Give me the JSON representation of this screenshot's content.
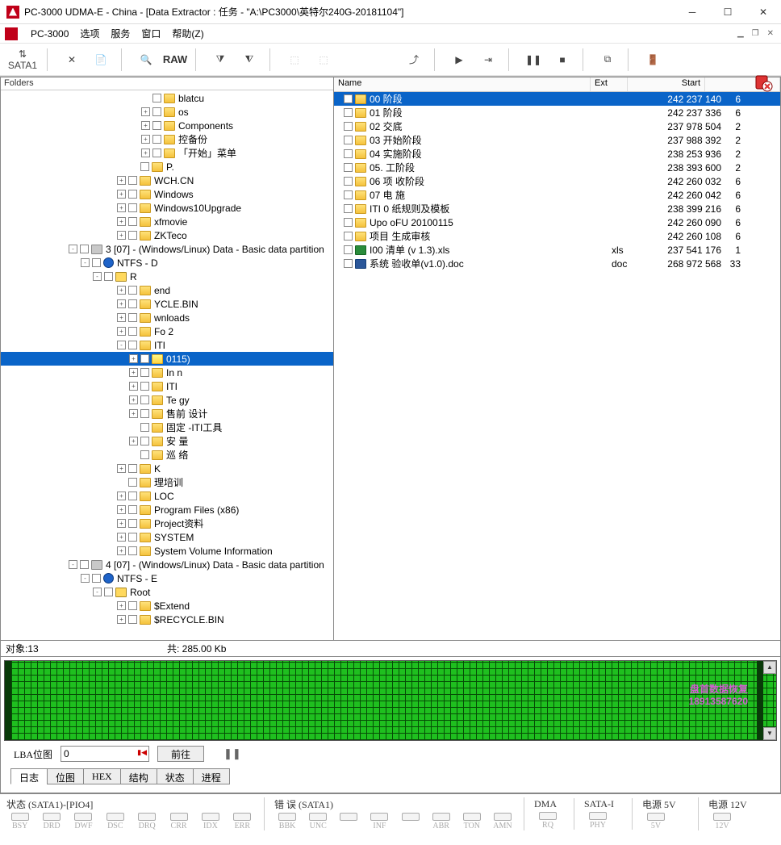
{
  "window": {
    "title": "PC-3000 UDMA-E - China - [Data Extractor : 任务 - \"A:\\PC3000\\英特尔240G-20181104\"]"
  },
  "menu": {
    "pc3000": "PC-3000",
    "options": "选项",
    "services": "服务",
    "window": "窗口",
    "help": "帮助(Z)"
  },
  "toolbar": {
    "sata": "SATA1",
    "raw": "RAW"
  },
  "folders": {
    "title": "Folders",
    "tree": [
      {
        "ind": 170,
        "exp": "",
        "name": "blatcu",
        "blur": true
      },
      {
        "ind": 170,
        "exp": "+",
        "name": "      os",
        "blur": true
      },
      {
        "ind": 170,
        "exp": "+",
        "name": "      Components"
      },
      {
        "ind": 170,
        "exp": "+",
        "name": "     控备份",
        "blur": true
      },
      {
        "ind": 170,
        "exp": "+",
        "name": "     「开始」菜单",
        "blur": true
      },
      {
        "ind": 155,
        "exp": "",
        "name": "P.",
        "blur": true
      },
      {
        "ind": 140,
        "exp": "+",
        "name": "WCH.CN"
      },
      {
        "ind": 140,
        "exp": "+",
        "name": "Windows"
      },
      {
        "ind": 140,
        "exp": "+",
        "name": "Windows10Upgrade"
      },
      {
        "ind": 140,
        "exp": "+",
        "name": "xfmovie"
      },
      {
        "ind": 140,
        "exp": "+",
        "name": "ZKTeco"
      },
      {
        "ind": 80,
        "exp": "-",
        "name": "3 [07] - (Windows/Linux) Data - Basic data partition",
        "icon": "drive"
      },
      {
        "ind": 95,
        "exp": "-",
        "name": "NTFS - D",
        "icon": "ntfs"
      },
      {
        "ind": 110,
        "exp": "-",
        "name": "R",
        "icon": "root",
        "blur": true
      },
      {
        "ind": 140,
        "exp": "+",
        "name": "         end",
        "blur": true
      },
      {
        "ind": 140,
        "exp": "+",
        "name": "         YCLE.BIN",
        "blur": true
      },
      {
        "ind": 140,
        "exp": "+",
        "name": "       wnloads",
        "blur": true
      },
      {
        "ind": 140,
        "exp": "+",
        "name": "Fo       2",
        "blur": true
      },
      {
        "ind": 140,
        "exp": "-",
        "name": "ITI",
        "blur": true
      },
      {
        "ind": 155,
        "exp": "+",
        "name": "                           0115)",
        "sel": true
      },
      {
        "ind": 155,
        "exp": "+",
        "name": "In        n",
        "blur": true
      },
      {
        "ind": 155,
        "exp": "+",
        "name": "ITI",
        "blur": true
      },
      {
        "ind": 155,
        "exp": "+",
        "name": "Te      gy",
        "blur": true
      },
      {
        "ind": 155,
        "exp": "+",
        "name": "售前     设计",
        "blur": true
      },
      {
        "ind": 155,
        "exp": "",
        "name": "固定    -ITI工具",
        "blur": true
      },
      {
        "ind": 155,
        "exp": "+",
        "name": "安    量",
        "blur": true
      },
      {
        "ind": 155,
        "exp": "",
        "name": "巡     络",
        "blur": true
      },
      {
        "ind": 140,
        "exp": "+",
        "name": "K",
        "blur": true
      },
      {
        "ind": 140,
        "exp": "",
        "name": "      理培训",
        "blur": true
      },
      {
        "ind": 140,
        "exp": "+",
        "name": "LOC",
        "blur": true
      },
      {
        "ind": 140,
        "exp": "+",
        "name": "Program Files (x86)"
      },
      {
        "ind": 140,
        "exp": "+",
        "name": "Project资料"
      },
      {
        "ind": 140,
        "exp": "+",
        "name": "SYSTEM"
      },
      {
        "ind": 140,
        "exp": "+",
        "name": "System Volume Information"
      },
      {
        "ind": 80,
        "exp": "-",
        "name": "4 [07] - (Windows/Linux) Data - Basic data partition",
        "icon": "drive"
      },
      {
        "ind": 95,
        "exp": "-",
        "name": "NTFS - E",
        "icon": "ntfs"
      },
      {
        "ind": 110,
        "exp": "-",
        "name": "Root",
        "icon": "root"
      },
      {
        "ind": 140,
        "exp": "+",
        "name": "$Extend"
      },
      {
        "ind": 140,
        "exp": "+",
        "name": "$RECYCLE.BIN"
      }
    ]
  },
  "files": {
    "cols": {
      "name": "Name",
      "ext": "Ext",
      "start": "Start"
    },
    "rows": [
      {
        "name": "00       阶段",
        "ext": "",
        "start": "242 237 140",
        "last": "6",
        "sel": true
      },
      {
        "name": "01       阶段",
        "ext": "",
        "start": "242 237 336",
        "last": "6"
      },
      {
        "name": "02       交底",
        "ext": "",
        "start": "237 978 504",
        "last": "2"
      },
      {
        "name": "03       开始阶段",
        "ext": "",
        "start": "237 988 392",
        "last": "2"
      },
      {
        "name": "04       实施阶段",
        "ext": "",
        "start": "238 253 936",
        "last": "2"
      },
      {
        "name": "05.      工阶段",
        "ext": "",
        "start": "238 393 600",
        "last": "2"
      },
      {
        "name": "06 项     收阶段",
        "ext": "",
        "start": "242 260 032",
        "last": "6"
      },
      {
        "name": "07 电     施",
        "ext": "",
        "start": "242 260 042",
        "last": "6"
      },
      {
        "name": "ITI 0    纸规则及模板",
        "ext": "",
        "start": "238 399 216",
        "last": "6"
      },
      {
        "name": "Upo     oFU 20100115",
        "ext": "",
        "start": "242 260 090",
        "last": "6"
      },
      {
        "name": "项目     生成审核",
        "ext": "",
        "start": "242 260 108",
        "last": "6"
      },
      {
        "name": "I00      清单 (v 1.3).xls",
        "ext": "xls",
        "start": "237 541 176",
        "last": "1",
        "icon": "xls"
      },
      {
        "name": "系统     验收单(v1.0).doc",
        "ext": "doc",
        "start": "268 972 568",
        "last": "33",
        "icon": "doc"
      }
    ]
  },
  "status": {
    "objects": "对象:13",
    "total": "共:   285.00 Kb"
  },
  "lba": {
    "label": "LBA位图",
    "value": "0",
    "goto": "前往"
  },
  "tabs": [
    "日志",
    "位图",
    "HEX",
    "结构",
    "状态",
    "进程"
  ],
  "watermark": {
    "line1": "盘首数据恢复",
    "line2": "18913587620"
  },
  "bottom": {
    "sata_state": "状态 (SATA1)-[PIO4]",
    "err": "错 误 (SATA1)",
    "dma": "DMA",
    "satai": "SATA-I",
    "p5": "电源 5V",
    "p12": "电源 12V",
    "leds1": [
      "BSY",
      "DRD",
      "DWF",
      "DSC",
      "DRQ",
      "CRR",
      "IDX",
      "ERR"
    ],
    "leds2": [
      "BBK",
      "UNC",
      "",
      "INF",
      "",
      "ABR",
      "TON",
      "AMN"
    ],
    "dmal": "RQ",
    "satail": "PHY",
    "p5l": "5V",
    "p12l": "12V"
  }
}
